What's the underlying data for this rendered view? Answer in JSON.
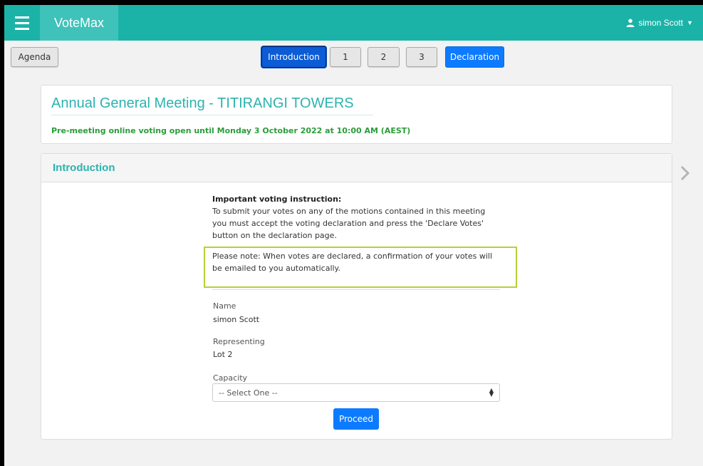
{
  "app": {
    "brand": "VoteMax",
    "user_name": "simon Scott"
  },
  "nav": {
    "agenda": "Agenda",
    "steps": [
      "Introduction",
      "1",
      "2",
      "3",
      "Declaration"
    ]
  },
  "meeting": {
    "title": "Annual General Meeting - TITIRANGI TOWERS",
    "subtitle": "Pre-meeting online voting open until Monday 3 October 2022 at 10:00 AM (AEST)"
  },
  "intro": {
    "header": "Introduction",
    "instruction_title": "Important voting instruction:",
    "instruction_body": "To submit your votes on any of the motions contained in this meeting you must accept the voting declaration and press the 'Declare Votes' button on the declaration page.",
    "note": "Please note: When votes are declared, a confirmation of your votes will be emailed to you automatically.",
    "name_label": "Name",
    "name_value": "simon Scott",
    "representing_label": "Representing",
    "representing_value": "Lot 2",
    "capacity_label": "Capacity",
    "capacity_selected": "-- Select One --",
    "proceed": "Proceed"
  },
  "colors": {
    "topbar": "#1bb3a8",
    "accent_teal": "#2bb3ad",
    "primary_blue": "#0d7bff",
    "green_text": "#2a9d3a",
    "highlight_box": "#b7d133"
  },
  "icons": {
    "menu": "hamburger-icon",
    "user": "user-icon",
    "next": "chevron-right-icon"
  }
}
